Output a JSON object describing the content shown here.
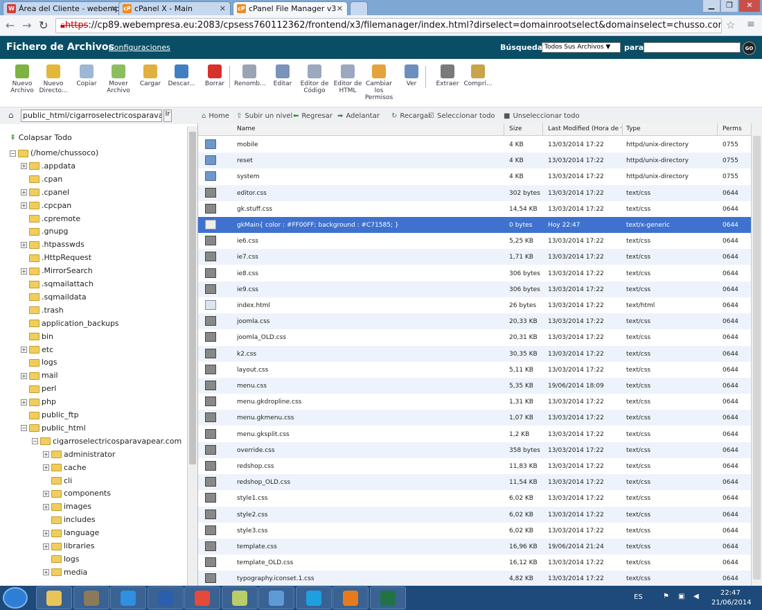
{
  "browser": {
    "tabs": [
      {
        "label": "Área del Cliente - webemp",
        "fav": "W",
        "color": "#d43d3d"
      },
      {
        "label": "cPanel X - Main",
        "fav": "cP",
        "color": "#f08a1e"
      },
      {
        "label": "cPanel File Manager v3",
        "fav": "cP",
        "color": "#f08a1e"
      }
    ],
    "url_scheme": "https",
    "url_rest": "://cp89.webempresa.eu:2083/cpsess760112362/frontend/x3/filemanager/index.html?dirselect=domainrootselect&domainselect=chusso.com&di"
  },
  "app": {
    "title": "Fichero de Archivos",
    "settings_link": "Configuraciones",
    "search_label": "Búsqueda",
    "search_scope": "Todos Sus Archivos ▼",
    "for_label": "para",
    "go_label": "GO"
  },
  "toolbar": [
    {
      "label": "Nuevo Archivo",
      "name": "new-file-button",
      "color": "#7cb342"
    },
    {
      "label": "Nuevo Directo...",
      "name": "new-folder-button",
      "color": "#e2b73c"
    },
    {
      "label": "Copiar",
      "name": "copy-button",
      "color": "#9fb7d6"
    },
    {
      "label": "Mover Archivo",
      "name": "move-button",
      "color": "#8bbf5d"
    },
    {
      "label": "Cargar",
      "name": "upload-button",
      "color": "#e0b13e"
    },
    {
      "label": "Descar...",
      "name": "download-button",
      "color": "#3f7fc2"
    },
    {
      "label": "Borrar",
      "name": "delete-button",
      "color": "#d7312d"
    },
    {
      "label": "Renomb...",
      "name": "rename-button",
      "color": "#9aa5b4"
    },
    {
      "label": "Editar",
      "name": "edit-button",
      "color": "#7b93bb"
    },
    {
      "label": "Editor de Código",
      "name": "code-editor-button",
      "color": "#9aa8c0"
    },
    {
      "label": "Editor de HTML",
      "name": "html-editor-button",
      "color": "#9aa8c0"
    },
    {
      "label": "Cambiar los Permisos",
      "name": "permissions-button",
      "color": "#e6a23c"
    },
    {
      "label": "Ver",
      "name": "view-button",
      "color": "#6b8fbf"
    },
    {
      "label": "Extraer",
      "name": "extract-button",
      "color": "#7a7a7a"
    },
    {
      "label": "Compri...",
      "name": "compress-button",
      "color": "#c9a24a"
    }
  ],
  "path_input": "public_html/cigarroselectricosparavapea",
  "path_go": "Ir",
  "actions": [
    {
      "label": "Home",
      "name": "home-action",
      "icon": "⌂"
    },
    {
      "label": "Subir un nivel",
      "name": "up-level-action",
      "icon": "⇧"
    },
    {
      "label": "Regresar",
      "name": "back-action",
      "icon": "⬅"
    },
    {
      "label": "Adelantar",
      "name": "forward-action",
      "icon": "➡"
    },
    {
      "label": "Recargar",
      "name": "reload-action",
      "icon": "↻"
    },
    {
      "label": "Seleccionar todo",
      "name": "select-all-action",
      "icon": "☑"
    },
    {
      "label": "Unseleccionar todo",
      "name": "unselect-all-action",
      "icon": "■"
    }
  ],
  "tree": {
    "collapse_all": "Colapsar Todo",
    "items": [
      {
        "label": "(/home/chussoco)",
        "indent": 0,
        "pm": "-"
      },
      {
        "label": ".appdata",
        "indent": 1,
        "pm": "+"
      },
      {
        "label": ".cpan",
        "indent": 1,
        "pm": ""
      },
      {
        "label": ".cpanel",
        "indent": 1,
        "pm": "+"
      },
      {
        "label": ".cpcpan",
        "indent": 1,
        "pm": "+"
      },
      {
        "label": ".cpremote",
        "indent": 1,
        "pm": ""
      },
      {
        "label": ".gnupg",
        "indent": 1,
        "pm": ""
      },
      {
        "label": ".htpasswds",
        "indent": 1,
        "pm": "+"
      },
      {
        "label": ".HttpRequest",
        "indent": 1,
        "pm": ""
      },
      {
        "label": ".MirrorSearch",
        "indent": 1,
        "pm": "+"
      },
      {
        "label": ".sqmailattach",
        "indent": 1,
        "pm": ""
      },
      {
        "label": ".sqmaildata",
        "indent": 1,
        "pm": ""
      },
      {
        "label": ".trash",
        "indent": 1,
        "pm": ""
      },
      {
        "label": "application_backups",
        "indent": 1,
        "pm": ""
      },
      {
        "label": "bin",
        "indent": 1,
        "pm": ""
      },
      {
        "label": "etc",
        "indent": 1,
        "pm": "+"
      },
      {
        "label": "logs",
        "indent": 1,
        "pm": ""
      },
      {
        "label": "mail",
        "indent": 1,
        "pm": "+"
      },
      {
        "label": "perl",
        "indent": 1,
        "pm": ""
      },
      {
        "label": "php",
        "indent": 1,
        "pm": "+"
      },
      {
        "label": "public_ftp",
        "indent": 1,
        "pm": ""
      },
      {
        "label": "public_html",
        "indent": 1,
        "pm": "-"
      },
      {
        "label": "cigarroselectricosparavapear.com",
        "indent": 2,
        "pm": "-"
      },
      {
        "label": "administrator",
        "indent": 3,
        "pm": "+"
      },
      {
        "label": "cache",
        "indent": 3,
        "pm": "+"
      },
      {
        "label": "cli",
        "indent": 3,
        "pm": ""
      },
      {
        "label": "components",
        "indent": 3,
        "pm": "+"
      },
      {
        "label": "images",
        "indent": 3,
        "pm": "+"
      },
      {
        "label": "includes",
        "indent": 3,
        "pm": ""
      },
      {
        "label": "language",
        "indent": 3,
        "pm": "+"
      },
      {
        "label": "libraries",
        "indent": 3,
        "pm": "+"
      },
      {
        "label": "logs",
        "indent": 3,
        "pm": ""
      },
      {
        "label": "media",
        "indent": 3,
        "pm": "+"
      }
    ]
  },
  "columns": {
    "name": "Name",
    "size": "Size",
    "modified": "Last Modified (Hora de ve",
    "type": "Type",
    "perms": "Perms"
  },
  "files": [
    {
      "name": "mobile",
      "size": "4 KB",
      "modified": "13/03/2014 17:22",
      "type": "httpd/unix-directory",
      "perms": "0755",
      "kind": "dir"
    },
    {
      "name": "reset",
      "size": "4 KB",
      "modified": "13/03/2014 17:22",
      "type": "httpd/unix-directory",
      "perms": "0755",
      "kind": "dir"
    },
    {
      "name": "system",
      "size": "4 KB",
      "modified": "13/03/2014 17:22",
      "type": "httpd/unix-directory",
      "perms": "0755",
      "kind": "dir"
    },
    {
      "name": "editor.css",
      "size": "302 bytes",
      "modified": "13/03/2014 17:22",
      "type": "text/css",
      "perms": "0644",
      "kind": "css"
    },
    {
      "name": "gk.stuff.css",
      "size": "14,54 KB",
      "modified": "13/03/2014 17:22",
      "type": "text/css",
      "perms": "0644",
      "kind": "css"
    },
    {
      "name": "gkMain{ color : #FF00FF; background : #C71585; }",
      "size": "0 bytes",
      "modified": "Hoy 22:47",
      "type": "text/x-generic",
      "perms": "0644",
      "kind": "txt",
      "selected": true
    },
    {
      "name": "ie6.css",
      "size": "5,25 KB",
      "modified": "13/03/2014 17:22",
      "type": "text/css",
      "perms": "0644",
      "kind": "css"
    },
    {
      "name": "ie7.css",
      "size": "1,71 KB",
      "modified": "13/03/2014 17:22",
      "type": "text/css",
      "perms": "0644",
      "kind": "css"
    },
    {
      "name": "ie8.css",
      "size": "306 bytes",
      "modified": "13/03/2014 17:22",
      "type": "text/css",
      "perms": "0644",
      "kind": "css"
    },
    {
      "name": "ie9.css",
      "size": "306 bytes",
      "modified": "13/03/2014 17:22",
      "type": "text/css",
      "perms": "0644",
      "kind": "css"
    },
    {
      "name": "index.html",
      "size": "26 bytes",
      "modified": "13/03/2014 17:22",
      "type": "text/html",
      "perms": "0644",
      "kind": "html"
    },
    {
      "name": "joomla.css",
      "size": "20,33 KB",
      "modified": "13/03/2014 17:22",
      "type": "text/css",
      "perms": "0644",
      "kind": "css"
    },
    {
      "name": "joomla_OLD.css",
      "size": "20,31 KB",
      "modified": "13/03/2014 17:22",
      "type": "text/css",
      "perms": "0644",
      "kind": "css"
    },
    {
      "name": "k2.css",
      "size": "30,35 KB",
      "modified": "13/03/2014 17:22",
      "type": "text/css",
      "perms": "0644",
      "kind": "css"
    },
    {
      "name": "layout.css",
      "size": "5,11 KB",
      "modified": "13/03/2014 17:22",
      "type": "text/css",
      "perms": "0644",
      "kind": "css"
    },
    {
      "name": "menu.css",
      "size": "5,35 KB",
      "modified": "19/06/2014 18:09",
      "type": "text/css",
      "perms": "0644",
      "kind": "css"
    },
    {
      "name": "menu.gkdropline.css",
      "size": "1,31 KB",
      "modified": "13/03/2014 17:22",
      "type": "text/css",
      "perms": "0644",
      "kind": "css"
    },
    {
      "name": "menu.gkmenu.css",
      "size": "1,07 KB",
      "modified": "13/03/2014 17:22",
      "type": "text/css",
      "perms": "0644",
      "kind": "css"
    },
    {
      "name": "menu.gksplit.css",
      "size": "1,2 KB",
      "modified": "13/03/2014 17:22",
      "type": "text/css",
      "perms": "0644",
      "kind": "css"
    },
    {
      "name": "override.css",
      "size": "358 bytes",
      "modified": "13/03/2014 17:22",
      "type": "text/css",
      "perms": "0644",
      "kind": "css"
    },
    {
      "name": "redshop.css",
      "size": "11,83 KB",
      "modified": "13/03/2014 17:22",
      "type": "text/css",
      "perms": "0644",
      "kind": "css"
    },
    {
      "name": "redshop_OLD.css",
      "size": "11,54 KB",
      "modified": "13/03/2014 17:22",
      "type": "text/css",
      "perms": "0644",
      "kind": "css"
    },
    {
      "name": "style1.css",
      "size": "6,02 KB",
      "modified": "13/03/2014 17:22",
      "type": "text/css",
      "perms": "0644",
      "kind": "css"
    },
    {
      "name": "style2.css",
      "size": "6,02 KB",
      "modified": "13/03/2014 17:22",
      "type": "text/css",
      "perms": "0644",
      "kind": "css"
    },
    {
      "name": "style3.css",
      "size": "6,02 KB",
      "modified": "13/03/2014 17:22",
      "type": "text/css",
      "perms": "0644",
      "kind": "css"
    },
    {
      "name": "template.css",
      "size": "16,96 KB",
      "modified": "19/06/2014 21:24",
      "type": "text/css",
      "perms": "0644",
      "kind": "css"
    },
    {
      "name": "template_OLD.css",
      "size": "16,12 KB",
      "modified": "13/03/2014 17:22",
      "type": "text/css",
      "perms": "0644",
      "kind": "css"
    },
    {
      "name": "typography.iconset.1.css",
      "size": "4,82 KB",
      "modified": "13/03/2014 17:22",
      "type": "text/css",
      "perms": "0644",
      "kind": "css"
    }
  ],
  "taskbar": {
    "apps": [
      {
        "name": "taskbar-explorer",
        "color": "#e8c45a"
      },
      {
        "name": "taskbar-gimp",
        "color": "#8a7a5a"
      },
      {
        "name": "taskbar-ie",
        "color": "#2f8fe0"
      },
      {
        "name": "taskbar-word",
        "color": "#2b5fad"
      },
      {
        "name": "taskbar-chrome",
        "color": "#e34a3a"
      },
      {
        "name": "taskbar-notes",
        "color": "#b8cc6a"
      },
      {
        "name": "taskbar-people",
        "color": "#5e9ad8"
      },
      {
        "name": "taskbar-skype",
        "color": "#1ea0e0"
      },
      {
        "name": "taskbar-firefox",
        "color": "#e87a1e"
      },
      {
        "name": "taskbar-excel",
        "color": "#217346"
      }
    ],
    "lang": "ES",
    "time": "22:47",
    "date": "21/06/2014"
  }
}
